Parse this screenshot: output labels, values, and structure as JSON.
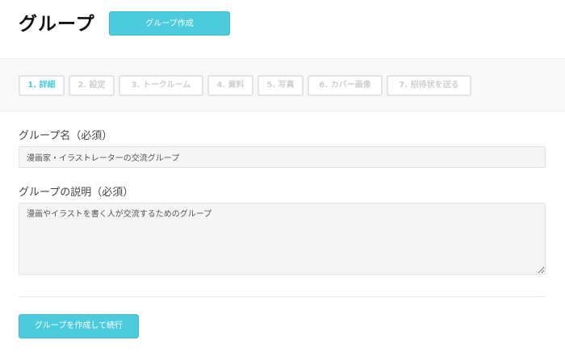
{
  "header": {
    "title": "グループ",
    "create_button_label": "グループ作成"
  },
  "steps": [
    {
      "label": "1. 詳細",
      "active": true
    },
    {
      "label": "2. 設定",
      "active": false
    },
    {
      "label": "3. トークルーム",
      "active": false
    },
    {
      "label": "4. 資料",
      "active": false
    },
    {
      "label": "5. 写真",
      "active": false
    },
    {
      "label": "6. カバー画像",
      "active": false
    },
    {
      "label": "7. 招待状を送る",
      "active": false
    }
  ],
  "form": {
    "name_label": "グループ名（必須）",
    "name_value": "漫画家・イラストレーターの交流グループ",
    "description_label": "グループの説明（必須）",
    "description_value": "漫画やイラストを書く人が交流するためのグループ"
  },
  "submit_label": "グループを作成して続行",
  "colors": {
    "accent": "#4ccbdc",
    "step_inactive": "#cfcfcf",
    "input_background": "#f5f5f5"
  }
}
